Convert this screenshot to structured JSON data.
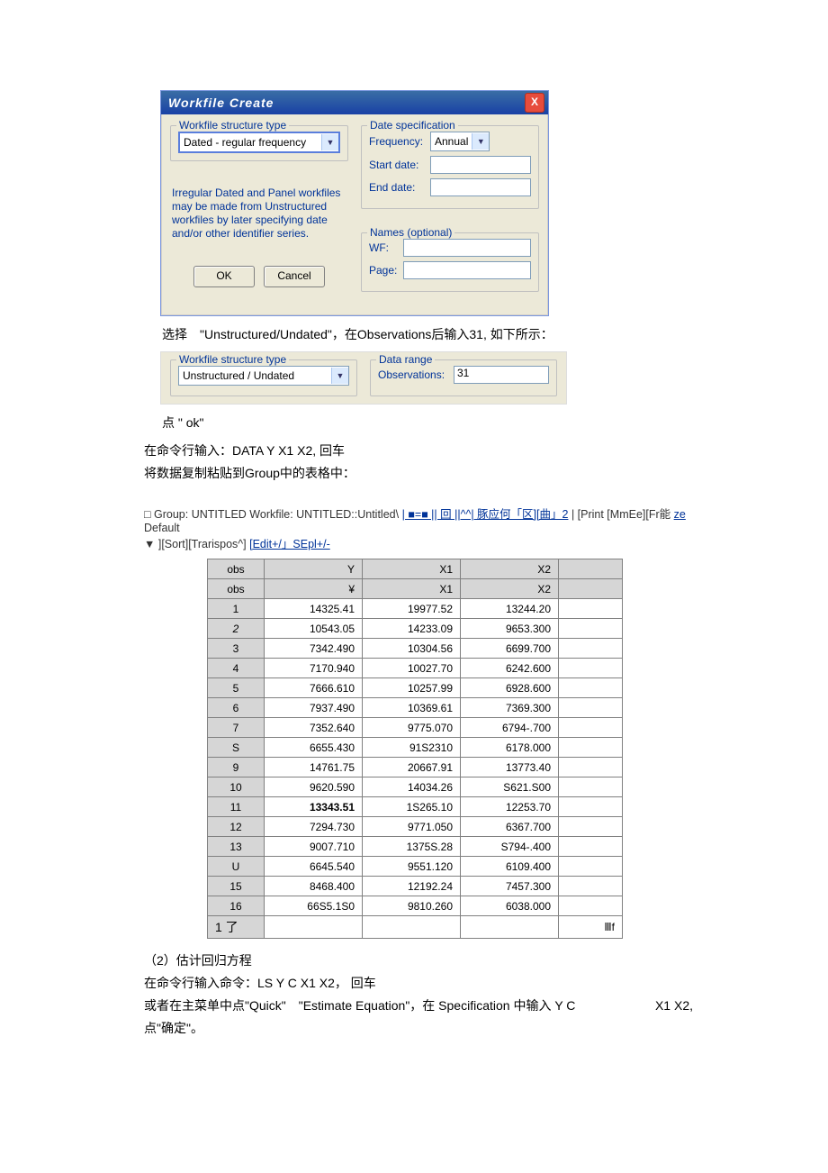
{
  "dialog1": {
    "title": "Workfile Create",
    "close": "X",
    "left_legend": "Workfile structure type",
    "combo1": "Dated - regular frequency",
    "note": "Irregular Dated and Panel workfiles may be made from Unstructured workfiles by later specifying date and/or other identifier series.",
    "ok": "OK",
    "cancel": "Cancel",
    "right_legend1": "Date specification",
    "freq_label": "Frequency:",
    "freq_val": "Annual",
    "start_label": "Start date:",
    "end_label": "End date:",
    "right_legend2": "Names (optional)",
    "wf_label": "WF:",
    "page_label": "Page:"
  },
  "text1": "选择　\"Unstructured/Undated\"，在Observations后输入31, 如下所示：",
  "panel2": {
    "left_legend": "Workfile structure type",
    "combo": "Unstructured / Undated",
    "right_legend": "Data range",
    "obs_label": "Observations:",
    "obs_val": "31"
  },
  "text2": "点 \" ok\"",
  "text3": "在命令行输入：DATA Y X1 X2, 回车",
  "text4": "将数据复制粘贴到Group中的表格中：",
  "groupline": {
    "a": "□ Group: UNTITLED Workfile: UNTITLED::Untitled\\",
    "b": "| ■=■ || 回 ||^^| 豚应何「区][曲」2",
    "c": "| [Print [MmEe][Fr能",
    "d": "ze",
    "e": " Default",
    "f": "▼ ][Sort][Trarispos^] ",
    "g": "[Edit+/」SEpl+/-"
  },
  "table_headers": [
    "obs",
    "Y",
    "X1",
    "X2",
    ""
  ],
  "table_headers2": [
    "obs",
    "¥",
    "X1",
    "X2",
    ""
  ],
  "rows": [
    [
      "1",
      "14325.41",
      "19977.52",
      "13244.20",
      ""
    ],
    [
      "2",
      "10543.05",
      "14233.09",
      "9653.300",
      ""
    ],
    [
      "3",
      "7342.490",
      "10304.56",
      "6699.700",
      ""
    ],
    [
      "4",
      "7170.940",
      "10027.70",
      "6242.600",
      ""
    ],
    [
      "5",
      "7666.610",
      "10257.99",
      "6928.600",
      ""
    ],
    [
      "6",
      "7937.490",
      "10369.61",
      "7369.300",
      ""
    ],
    [
      "7",
      "7352.640",
      "9775.070",
      "6794-.700",
      ""
    ],
    [
      "S",
      "6655.430",
      "91S2310",
      "6178.000",
      ""
    ],
    [
      "9",
      "14761.75",
      "20667.91",
      "13773.40",
      ""
    ],
    [
      "10",
      "9620.590",
      "14034.26",
      "S621.S00",
      ""
    ],
    [
      "11",
      "13343.51",
      "1S265.10",
      "12253.70",
      ""
    ],
    [
      "12",
      "7294.730",
      "9771.050",
      "6367.700",
      ""
    ],
    [
      "13",
      "9007.710",
      "1375S.28",
      "S794-.400",
      ""
    ],
    [
      "U",
      "6645.540",
      "9551.120",
      "6109.400",
      ""
    ],
    [
      "15",
      "8468.400",
      "12192.24",
      "7457.300",
      ""
    ],
    [
      "16",
      "66S5.1S0",
      "9810.260",
      "6038.000",
      ""
    ]
  ],
  "footrow": [
    "1 了",
    "",
    "",
    "",
    "Ⅲf"
  ],
  "text5": "（2）估计回归方程",
  "text6": "在命令行输入命令：LS Y C X1 X2，  回车",
  "text7a": "或者在主菜单中点\"Quick\"　\"Estimate Equation\"，在  Specification 中输入  Y C",
  "text7b": "X1 X2,",
  "text8": "点\"确定\"。"
}
